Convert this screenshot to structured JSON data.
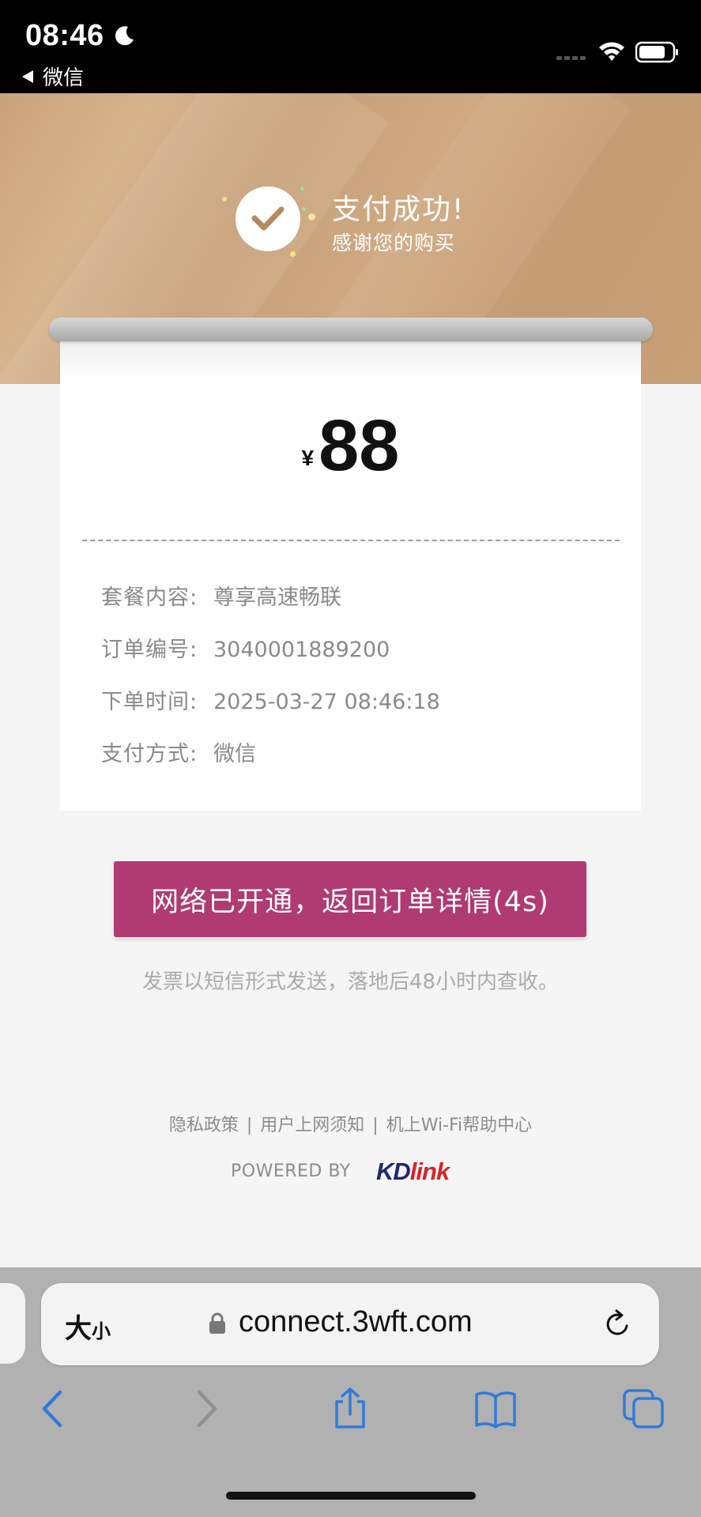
{
  "status_bar": {
    "time": "08:46",
    "back_app": "微信"
  },
  "header": {
    "title": "支付成功!",
    "subtitle": "感谢您的购买"
  },
  "receipt": {
    "currency": "¥",
    "amount": "88",
    "details": [
      {
        "label": "套餐内容:",
        "value": "尊享高速畅联"
      },
      {
        "label": "订单编号:",
        "value": "3040001889200"
      },
      {
        "label": "下单时间:",
        "value": "2025-03-27 08:46:18"
      },
      {
        "label": "支付方式:",
        "value": "微信"
      }
    ]
  },
  "actions": {
    "return_label": "网络已开通，返回订单详情(4s)",
    "invoice_note": "发票以短信形式发送，落地后48小时内查收。"
  },
  "footer": {
    "links": [
      "隐私政策",
      "用户上网须知",
      "机上Wi-Fi帮助中心"
    ],
    "separator": "|",
    "powered_by": "POWERED BY",
    "logo_kd": "KD",
    "logo_link": "link"
  },
  "browser": {
    "text_size_big": "大",
    "text_size_small": "小",
    "url": "connect.3wft.com"
  },
  "colors": {
    "accent": "#b03a72",
    "header_gold": "#c9a27a",
    "active_nav": "#2f7bdd",
    "inactive_nav": "#8f8f8f"
  }
}
